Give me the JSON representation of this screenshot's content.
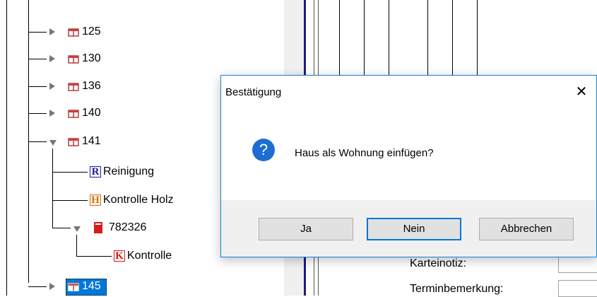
{
  "tree": {
    "nodes": [
      {
        "label": "125",
        "icon": "house-icon",
        "expanded": false
      },
      {
        "label": "130",
        "icon": "house-icon",
        "expanded": false
      },
      {
        "label": "136",
        "icon": "house-icon",
        "expanded": false
      },
      {
        "label": "140",
        "icon": "house-icon",
        "expanded": false
      },
      {
        "label": "141",
        "icon": "house-icon",
        "expanded": true
      },
      {
        "label": "Reinigung",
        "icon": "r-letter-icon"
      },
      {
        "label": "Kontrolle Holz",
        "icon": "h-letter-icon"
      },
      {
        "label": "782326",
        "icon": "red-book-icon",
        "expanded": true
      },
      {
        "label": "Kontrolle",
        "icon": "k-letter-icon"
      },
      {
        "label": "145",
        "icon": "house-icon",
        "expanded": false,
        "selected": true
      }
    ],
    "icon_letters": {
      "reinigung": "R",
      "holz": "H",
      "kontrolle": "K"
    }
  },
  "background": {
    "field_label_1": "Karteinotiz:",
    "field_label_2": "Terminbemerkung:"
  },
  "dialog": {
    "title": "Bestätigung",
    "close_glyph": "✕",
    "icon_glyph": "?",
    "message": "Haus als Wohnung einfügen?",
    "buttons": {
      "yes": "Ja",
      "no": "Nein",
      "cancel": "Abbrechen"
    }
  },
  "colors": {
    "accent": "#0078d7",
    "question_icon": "#1c6fd1",
    "dialog_footer": "#f0f0f0",
    "r_icon": "#1a1aa6",
    "h_icon": "#c8781e",
    "k_icon": "#d91a1a"
  }
}
